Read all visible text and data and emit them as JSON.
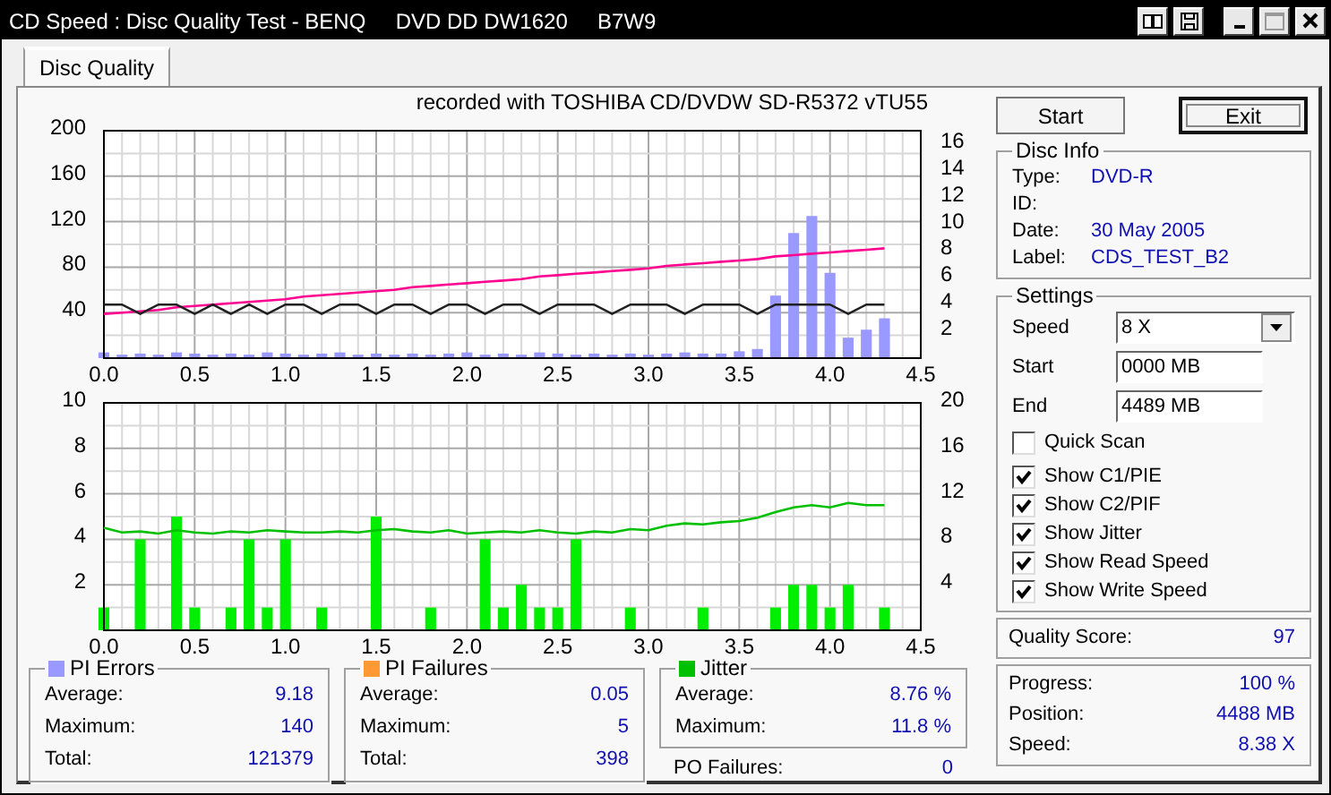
{
  "window": {
    "title": "CD Speed : Disc Quality Test - BENQ     DVD DD DW1620     B7W9"
  },
  "tabs": [
    {
      "label": "Disc Quality",
      "selected": true
    }
  ],
  "chart_header": "recorded with TOSHIBA CD/DVDW SD-R5372 vTU55",
  "charts": [
    {
      "layers": [
        {
          "chart_data": {
            "type": "bar",
            "grid": true,
            "x": [
              0.0,
              0.1,
              0.2,
              0.3,
              0.4,
              0.5,
              0.6,
              0.7,
              0.8,
              0.9,
              1.0,
              1.1,
              1.2,
              1.3,
              1.4,
              1.5,
              1.6,
              1.7,
              1.8,
              1.9,
              2.0,
              2.1,
              2.2,
              2.3,
              2.4,
              2.5,
              2.6,
              2.7,
              2.8,
              2.9,
              3.0,
              3.1,
              3.2,
              3.3,
              3.4,
              3.5,
              3.6,
              3.7,
              3.8,
              3.9,
              4.0,
              4.1,
              4.2,
              4.3
            ],
            "xlim": [
              0,
              4.5
            ],
            "xticks": [
              {
                "value": 0,
                "label": "0.0"
              },
              {
                "value": 0.5,
                "label": "0.5"
              },
              {
                "value": 1,
                "label": "1.0"
              },
              {
                "value": 1.5,
                "label": "1.5"
              },
              {
                "value": 2,
                "label": "2.0"
              },
              {
                "value": 2.5,
                "label": "2.5"
              },
              {
                "value": 3,
                "label": "3.0"
              },
              {
                "value": 3.5,
                "label": "3.5"
              },
              {
                "value": 4,
                "label": "4.0"
              },
              {
                "value": 4.5,
                "label": "4.5"
              }
            ],
            "ylim": [
              0,
              200
            ],
            "yticks": [
              {
                "value": 40,
                "label": "40"
              },
              {
                "value": 80,
                "label": "80"
              },
              {
                "value": 120,
                "label": "120"
              },
              {
                "value": 160,
                "label": "160"
              },
              {
                "value": 200,
                "label": "200"
              }
            ],
            "series": [
              {
                "color": "#9999ff",
                "values": [
                  5,
                  3,
                  4,
                  3,
                  5,
                  4,
                  3,
                  4,
                  3,
                  5,
                  4,
                  3,
                  4,
                  5,
                  3,
                  4,
                  3,
                  4,
                  3,
                  4,
                  5,
                  3,
                  4,
                  3,
                  5,
                  4,
                  3,
                  4,
                  3,
                  4,
                  3,
                  4,
                  5,
                  4,
                  4,
                  6,
                  8,
                  55,
                  110,
                  125,
                  75,
                  18,
                  25,
                  35
                ]
              }
            ]
          }
        },
        {
          "chart_data": {
            "type": "line",
            "x": [
              0.0,
              0.1,
              0.2,
              0.3,
              0.4,
              0.5,
              0.6,
              0.7,
              0.8,
              0.9,
              1.0,
              1.1,
              1.2,
              1.3,
              1.4,
              1.5,
              1.6,
              1.7,
              1.8,
              1.9,
              2.0,
              2.1,
              2.2,
              2.3,
              2.4,
              2.5,
              2.6,
              2.7,
              2.8,
              2.9,
              3.0,
              3.1,
              3.2,
              3.3,
              3.4,
              3.5,
              3.6,
              3.7,
              3.8,
              3.9,
              4.0,
              4.1,
              4.2,
              4.3
            ],
            "xlim": [
              0,
              4.5
            ],
            "ylim": [
              0,
              17
            ],
            "yticks": [
              {
                "value": 2,
                "label": "2"
              },
              {
                "value": 4,
                "label": "4"
              },
              {
                "value": 6,
                "label": "6"
              },
              {
                "value": 8,
                "label": "8"
              },
              {
                "value": 10,
                "label": "10"
              },
              {
                "value": 12,
                "label": "12"
              },
              {
                "value": 14,
                "label": "14"
              },
              {
                "value": 16,
                "label": "16"
              }
            ],
            "series": [
              {
                "color": "#ff0090",
                "values": [
                  3.3,
                  3.4,
                  3.5,
                  3.6,
                  3.8,
                  3.9,
                  4.0,
                  4.1,
                  4.2,
                  4.3,
                  4.4,
                  4.6,
                  4.7,
                  4.8,
                  4.9,
                  5.0,
                  5.1,
                  5.3,
                  5.4,
                  5.5,
                  5.6,
                  5.7,
                  5.8,
                  5.9,
                  6.1,
                  6.2,
                  6.3,
                  6.4,
                  6.5,
                  6.6,
                  6.7,
                  6.9,
                  7.0,
                  7.1,
                  7.2,
                  7.3,
                  7.4,
                  7.6,
                  7.7,
                  7.8,
                  7.9,
                  8.0,
                  8.1,
                  8.2
                ]
              },
              {
                "color": "#202020",
                "values": [
                  4,
                  4,
                  3.3,
                  4,
                  4,
                  3.3,
                  4,
                  3.3,
                  4,
                  3.3,
                  4,
                  4,
                  3.3,
                  4,
                  4,
                  3.3,
                  4,
                  4,
                  3.3,
                  4,
                  4,
                  3.3,
                  4,
                  4,
                  3.3,
                  4,
                  4,
                  4,
                  3.3,
                  4,
                  4,
                  4,
                  3.3,
                  4,
                  4,
                  4,
                  3.3,
                  4,
                  4,
                  4,
                  4,
                  3.3,
                  4,
                  4
                ]
              }
            ]
          }
        }
      ]
    },
    {
      "layers": [
        {
          "chart_data": {
            "type": "bar",
            "grid": true,
            "x": [
              0.0,
              0.1,
              0.2,
              0.3,
              0.4,
              0.5,
              0.6,
              0.7,
              0.8,
              0.9,
              1.0,
              1.1,
              1.2,
              1.3,
              1.4,
              1.5,
              1.6,
              1.7,
              1.8,
              1.9,
              2.0,
              2.1,
              2.2,
              2.3,
              2.4,
              2.5,
              2.6,
              2.7,
              2.8,
              2.9,
              3.0,
              3.1,
              3.2,
              3.3,
              3.4,
              3.5,
              3.6,
              3.7,
              3.8,
              3.9,
              4.0,
              4.1,
              4.2,
              4.3
            ],
            "xlim": [
              0,
              4.5
            ],
            "xticks": [
              {
                "value": 0,
                "label": "0.0"
              },
              {
                "value": 0.5,
                "label": "0.5"
              },
              {
                "value": 1,
                "label": "1.0"
              },
              {
                "value": 1.5,
                "label": "1.5"
              },
              {
                "value": 2,
                "label": "2.0"
              },
              {
                "value": 2.5,
                "label": "2.5"
              },
              {
                "value": 3,
                "label": "3.0"
              },
              {
                "value": 3.5,
                "label": "3.5"
              },
              {
                "value": 4,
                "label": "4.0"
              },
              {
                "value": 4.5,
                "label": "4.5"
              }
            ],
            "ylim": [
              0,
              10
            ],
            "yticks": [
              {
                "value": 2,
                "label": "2"
              },
              {
                "value": 4,
                "label": "4"
              },
              {
                "value": 6,
                "label": "6"
              },
              {
                "value": 8,
                "label": "8"
              },
              {
                "value": 10,
                "label": "10"
              }
            ],
            "series": [
              {
                "color": "#00ee00",
                "values": [
                  1,
                  0,
                  4,
                  0,
                  5,
                  1,
                  0,
                  1,
                  4,
                  1,
                  4,
                  0,
                  1,
                  0,
                  0,
                  5,
                  0,
                  0,
                  1,
                  0,
                  0,
                  4,
                  1,
                  2,
                  1,
                  1,
                  4,
                  0,
                  0,
                  1,
                  0,
                  0,
                  0,
                  1,
                  0,
                  0,
                  0,
                  1,
                  2,
                  2,
                  1,
                  2,
                  0,
                  1
                ]
              }
            ]
          }
        },
        {
          "chart_data": {
            "type": "line",
            "x": [
              0.0,
              0.1,
              0.2,
              0.3,
              0.4,
              0.5,
              0.6,
              0.7,
              0.8,
              0.9,
              1.0,
              1.1,
              1.2,
              1.3,
              1.4,
              1.5,
              1.6,
              1.7,
              1.8,
              1.9,
              2.0,
              2.1,
              2.2,
              2.3,
              2.4,
              2.5,
              2.6,
              2.7,
              2.8,
              2.9,
              3.0,
              3.1,
              3.2,
              3.3,
              3.4,
              3.5,
              3.6,
              3.7,
              3.8,
              3.9,
              4.0,
              4.1,
              4.2,
              4.3
            ],
            "xlim": [
              0,
              4.5
            ],
            "ylim": [
              0,
              20
            ],
            "yticks": [
              {
                "value": 4,
                "label": "4"
              },
              {
                "value": 8,
                "label": "8"
              },
              {
                "value": 12,
                "label": "12"
              },
              {
                "value": 16,
                "label": "16"
              },
              {
                "value": 20,
                "label": "20"
              }
            ],
            "series": [
              {
                "color": "#00c000",
                "values": [
                  9.0,
                  8.6,
                  8.7,
                  8.5,
                  8.8,
                  8.6,
                  8.5,
                  8.7,
                  8.6,
                  8.8,
                  8.7,
                  8.6,
                  8.6,
                  8.7,
                  8.6,
                  8.8,
                  8.9,
                  8.7,
                  8.6,
                  8.8,
                  8.5,
                  8.6,
                  8.7,
                  8.6,
                  8.8,
                  8.6,
                  8.5,
                  8.7,
                  8.6,
                  8.9,
                  8.8,
                  9.2,
                  9.4,
                  9.3,
                  9.5,
                  9.6,
                  9.9,
                  10.4,
                  10.8,
                  11.0,
                  10.8,
                  11.2,
                  11.0,
                  11.0
                ]
              }
            ]
          }
        }
      ]
    }
  ],
  "stats": [
    {
      "title": "PI Errors",
      "color": "#9999ff",
      "rows": [
        {
          "label": "Average:",
          "value": "9.18"
        },
        {
          "label": "Maximum:",
          "value": "140"
        },
        {
          "label": "Total:",
          "value": "121379"
        }
      ]
    },
    {
      "title": "PI Failures",
      "color": "#ff9933",
      "rows": [
        {
          "label": "Average:",
          "value": "0.05"
        },
        {
          "label": "Maximum:",
          "value": "5"
        },
        {
          "label": "Total:",
          "value": "398"
        }
      ]
    },
    {
      "title": "Jitter",
      "color": "#00c000",
      "rows": [
        {
          "label": "Average:",
          "value": "8.76 %"
        },
        {
          "label": "Maximum:",
          "value": "11.8 %"
        }
      ]
    }
  ],
  "po_failures": {
    "label": "PO Failures:",
    "value": "0"
  },
  "buttons": [
    {
      "label": "Start",
      "default": false
    },
    {
      "label": "Exit",
      "default": true
    }
  ],
  "disc_info": {
    "title": "Disc Info",
    "fields": [
      {
        "label": "Type:",
        "value": "DVD-R"
      },
      {
        "label": "ID:"
      },
      {
        "label": "Date:",
        "value": "30 May 2005"
      },
      {
        "label": "Label:",
        "value": "CDS_TEST_B2"
      }
    ]
  },
  "settings": {
    "title": "Settings",
    "speed": {
      "label": "Speed",
      "value": "8 X"
    },
    "fields": [
      {
        "label": "Start",
        "value": "0000 MB"
      },
      {
        "label": "End",
        "value": "4489 MB"
      }
    ],
    "checkboxes": [
      {
        "label": "Quick Scan",
        "checked": false
      },
      {
        "label": "Show C1/PIE",
        "checked": true
      },
      {
        "label": "Show C2/PIF",
        "checked": true
      },
      {
        "label": "Show Jitter",
        "checked": true
      },
      {
        "label": "Show Read Speed",
        "checked": true
      },
      {
        "label": "Show Write Speed",
        "checked": true
      }
    ]
  },
  "quality_score": {
    "label": "Quality Score:",
    "value": "97"
  },
  "progress": [
    {
      "label": "Progress:",
      "value": "100 %"
    },
    {
      "label": "Position:",
      "value": "4488 MB"
    },
    {
      "label": "Speed:",
      "value": "8.38 X"
    }
  ]
}
